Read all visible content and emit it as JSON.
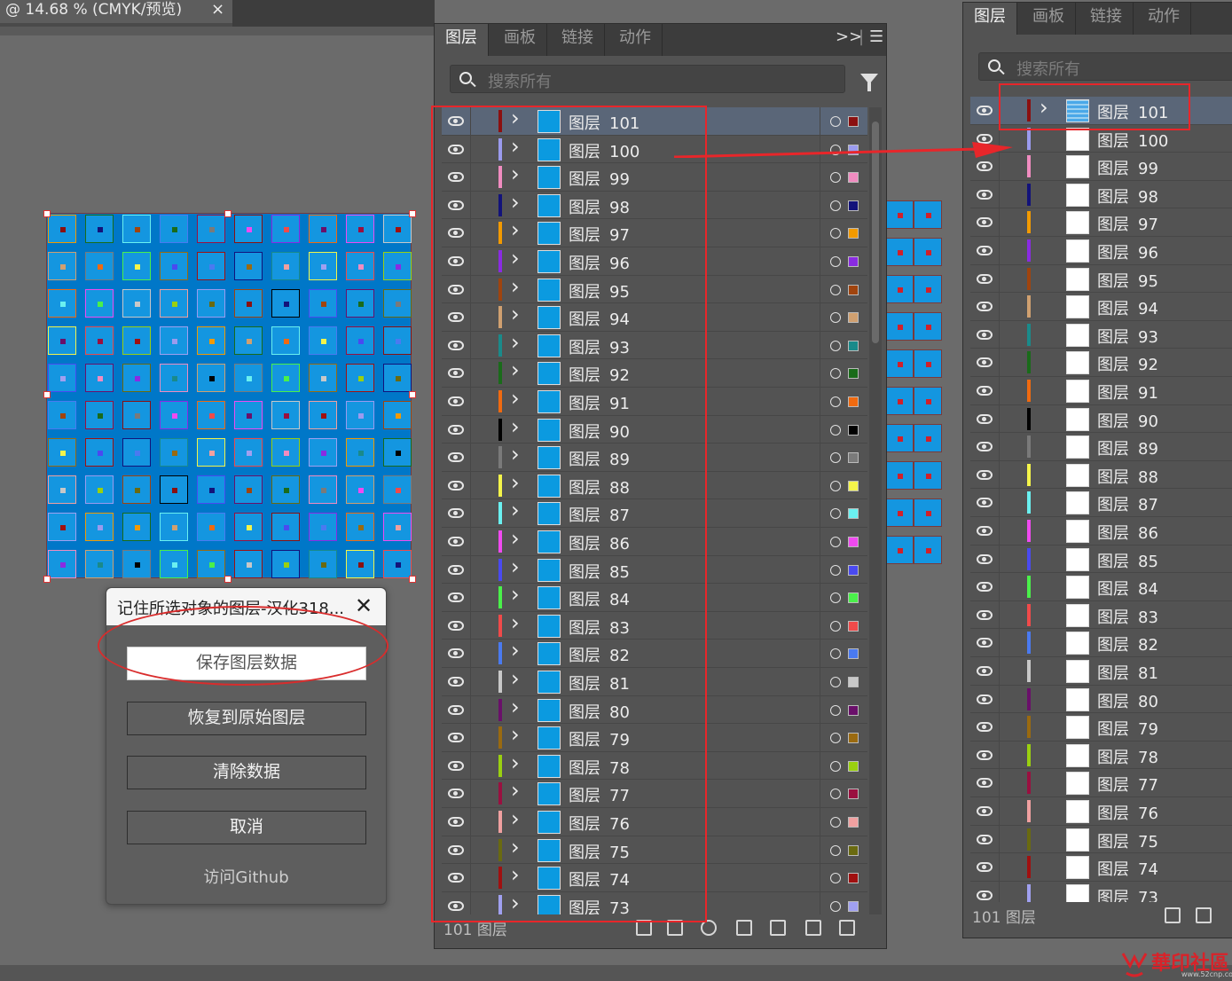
{
  "document": {
    "tab_title": "@ 14.68 % (CMYK/预览)",
    "close": "×"
  },
  "layers_panel_left": {
    "tabs": [
      "图层",
      "画板",
      "链接",
      "动作"
    ],
    "expand": ">>",
    "search_placeholder": "搜索所有",
    "footer_count": "101  图层"
  },
  "layers_panel_right": {
    "tabs": [
      "图层",
      "画板",
      "链接",
      "动作"
    ],
    "search_placeholder": "搜索所有",
    "footer_count": "101  图层"
  },
  "layer_prefix": "图层",
  "layers": [
    {
      "num": "101",
      "color": "#8b1010"
    },
    {
      "num": "100",
      "color": "#9b9bee"
    },
    {
      "num": "99",
      "color": "#f08cc0"
    },
    {
      "num": "98",
      "color": "#13137a"
    },
    {
      "num": "97",
      "color": "#f29a00"
    },
    {
      "num": "96",
      "color": "#8a2be2"
    },
    {
      "num": "95",
      "color": "#a0440e"
    },
    {
      "num": "94",
      "color": "#d0a070"
    },
    {
      "num": "93",
      "color": "#1a8a8a"
    },
    {
      "num": "92",
      "color": "#1a6b1a"
    },
    {
      "num": "91",
      "color": "#f06a10"
    },
    {
      "num": "90",
      "color": "#000000"
    },
    {
      "num": "89",
      "color": "#7a7a7a"
    },
    {
      "num": "88",
      "color": "#f4f44a"
    },
    {
      "num": "87",
      "color": "#6af0f0"
    },
    {
      "num": "86",
      "color": "#f04af0"
    },
    {
      "num": "85",
      "color": "#4a4af0"
    },
    {
      "num": "84",
      "color": "#4af04a"
    },
    {
      "num": "83",
      "color": "#f04a4a"
    },
    {
      "num": "82",
      "color": "#4a7af0"
    },
    {
      "num": "81",
      "color": "#c8c8c8"
    },
    {
      "num": "80",
      "color": "#6a106a"
    },
    {
      "num": "79",
      "color": "#9a6a10"
    },
    {
      "num": "78",
      "color": "#9ad010"
    },
    {
      "num": "77",
      "color": "#9a1040"
    },
    {
      "num": "76",
      "color": "#f0a0a0"
    },
    {
      "num": "75",
      "color": "#6a6a10"
    },
    {
      "num": "74",
      "color": "#a01010"
    },
    {
      "num": "73",
      "color": "#a0a0f0"
    }
  ],
  "dialog": {
    "title": "记住所选对象的图层-汉化318...",
    "close": "✕",
    "btn_save": "保存图层数据",
    "btn_restore": "恢复到原始图层",
    "btn_clear": "清除数据",
    "btn_cancel": "取消",
    "link": "访问Github"
  },
  "watermark": {
    "text": "華印社區",
    "url": "www.52cnp.com"
  },
  "colors": {
    "accent_red": "#e8262a",
    "thumb_blue": "#0b9ae0",
    "panel_bg": "#535353"
  }
}
